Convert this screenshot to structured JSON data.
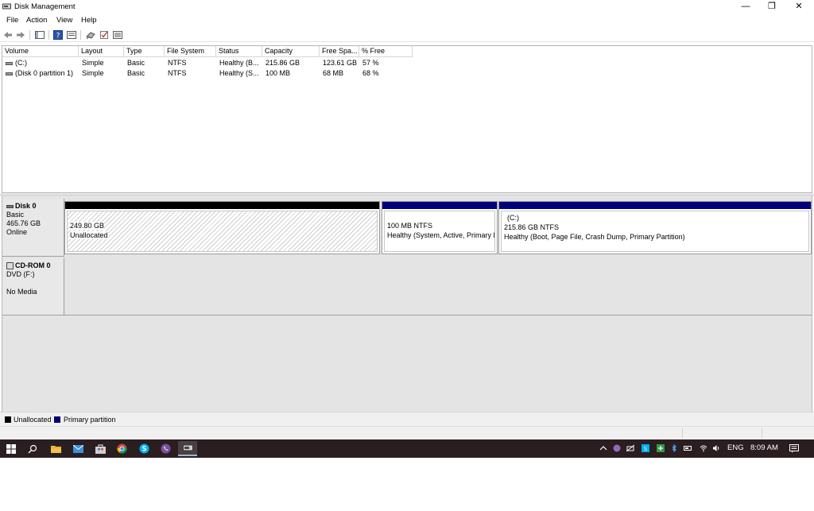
{
  "window": {
    "title": "Disk Management",
    "minimize": "—",
    "restore": "❐",
    "close": "✕"
  },
  "menu": [
    "File",
    "Action",
    "View",
    "Help"
  ],
  "toolbar": [
    "back-arrow-icon",
    "forward-arrow-icon",
    "console-tree-icon",
    "help-icon",
    "properties-icon",
    "connect-icon",
    "check-icon",
    "list-view-icon"
  ],
  "volume_table": {
    "columns": [
      "Volume",
      "Layout",
      "Type",
      "File System",
      "Status",
      "Capacity",
      "Free Spa...",
      "% Free"
    ],
    "rows": [
      [
        "(C:)",
        "Simple",
        "Basic",
        "NTFS",
        "Healthy (B...",
        "215.86 GB",
        "123.61 GB",
        "57 %"
      ],
      [
        "(Disk 0 partition 1)",
        "Simple",
        "Basic",
        "NTFS",
        "Healthy (S...",
        "100 MB",
        "68 MB",
        "68 %"
      ]
    ]
  },
  "disks": {
    "disk0": {
      "name": "Disk 0",
      "type": "Basic",
      "size": "465.76 GB",
      "status": "Online",
      "partitions": [
        {
          "line1": "",
          "line2": "249.80 GB",
          "line3": "Unallocated",
          "color": "#000000"
        },
        {
          "line1": "",
          "line2": "100 MB NTFS",
          "line3": "Healthy (System, Active, Primary P",
          "color": "#00007b"
        },
        {
          "line1": "(C:)",
          "line2": "215.86 GB NTFS",
          "line3": "Healthy (Boot, Page File, Crash Dump, Primary Partition)",
          "color": "#00007b"
        }
      ]
    },
    "cdrom0": {
      "name": "CD-ROM 0",
      "drive": "DVD (F:)",
      "status": "No Media"
    }
  },
  "legend": [
    {
      "label": "Unallocated",
      "color": "#000000"
    },
    {
      "label": "Primary partition",
      "color": "#00007b"
    }
  ],
  "taskbar": {
    "apps": [
      "windows-start-icon",
      "search-icon",
      "file-explorer-icon",
      "mail-icon",
      "store-icon",
      "chrome-icon",
      "skype-icon",
      "viber-icon",
      "disk-management-icon"
    ],
    "tray": {
      "language": "ENG",
      "time": "8:09 AM"
    }
  }
}
